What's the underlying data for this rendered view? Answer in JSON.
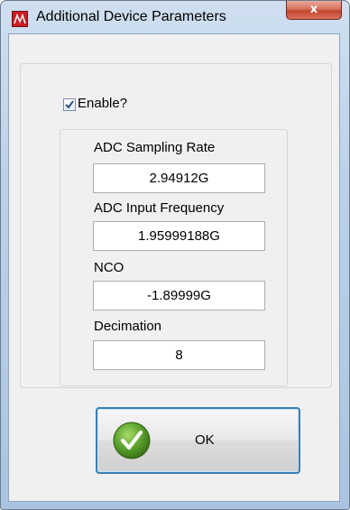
{
  "window": {
    "title": "Additional Device Parameters",
    "close_glyph": "x"
  },
  "enable": {
    "label": "Enable?",
    "checked": true
  },
  "fields": [
    {
      "label": "ADC Sampling Rate",
      "value": "2.94912G"
    },
    {
      "label": "ADC Input  Frequency",
      "value": "1.95999188G"
    },
    {
      "label": "NCO",
      "value": "-1.89999G"
    },
    {
      "label": "Decimation",
      "value": "8"
    }
  ],
  "ok_button": {
    "label": "OK",
    "icon": "green-checkmark-icon"
  },
  "colors": {
    "app_icon": "#c81d25",
    "close_button": "#c6452d",
    "ok_border": "#3c7fb1",
    "check_green": "#5aa02c"
  }
}
